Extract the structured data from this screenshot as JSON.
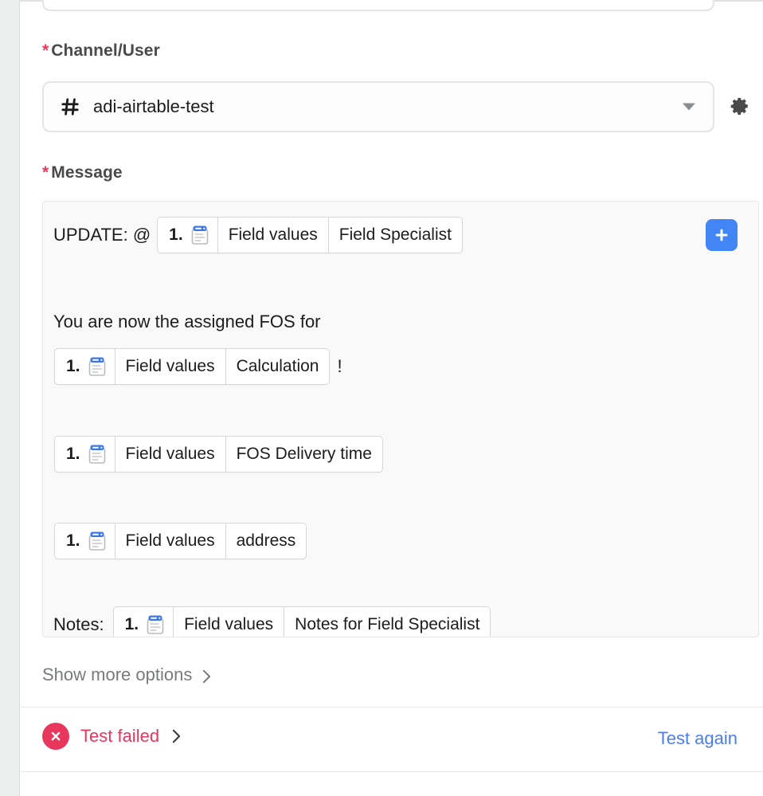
{
  "form": {
    "channel": {
      "label": "Channel/User",
      "required_marker": "*",
      "icon": "hash-icon",
      "value": "adi-airtable-test",
      "dropdown_icon": "chevron-down-icon",
      "settings_icon": "gear-icon"
    },
    "message": {
      "label": "Message",
      "required_marker": "*",
      "add_icon": "plus-icon",
      "lines": [
        {
          "prefix": "UPDATE: @",
          "token": {
            "index": "1.",
            "icon": "record-icon",
            "source": "Field values",
            "field": "Field Specialist"
          },
          "suffix": ""
        },
        {
          "prefix": "You are now the assigned FOS for",
          "token": null,
          "suffix": ""
        },
        {
          "prefix": "",
          "token": {
            "index": "1.",
            "icon": "record-icon",
            "source": "Field values",
            "field": "Calculation"
          },
          "suffix": "!"
        },
        {
          "prefix": "",
          "token": {
            "index": "1.",
            "icon": "record-icon",
            "source": "Field values",
            "field": "FOS Delivery time"
          },
          "suffix": ""
        },
        {
          "prefix": "",
          "token": {
            "index": "1.",
            "icon": "record-icon",
            "source": "Field values",
            "field": "address"
          },
          "suffix": ""
        },
        {
          "prefix": "Notes:",
          "token": {
            "index": "1.",
            "icon": "record-icon",
            "source": "Field values",
            "field": "Notes for Field Specialist"
          },
          "suffix": ""
        }
      ]
    },
    "show_more_options": {
      "label": "Show more options",
      "chevron_icon": "chevron-right-icon"
    }
  },
  "footer": {
    "status_icon": "x-circle-icon",
    "status_label": "Test failed",
    "status_chevron_icon": "chevron-right-icon",
    "retry_label": "Test again"
  },
  "colors": {
    "accent_blue": "#4285f4",
    "link_blue": "#4a7ef0",
    "error_red": "#e8365d",
    "required_star": "#ea3a5f",
    "message_bg": "#f9f9f9"
  }
}
